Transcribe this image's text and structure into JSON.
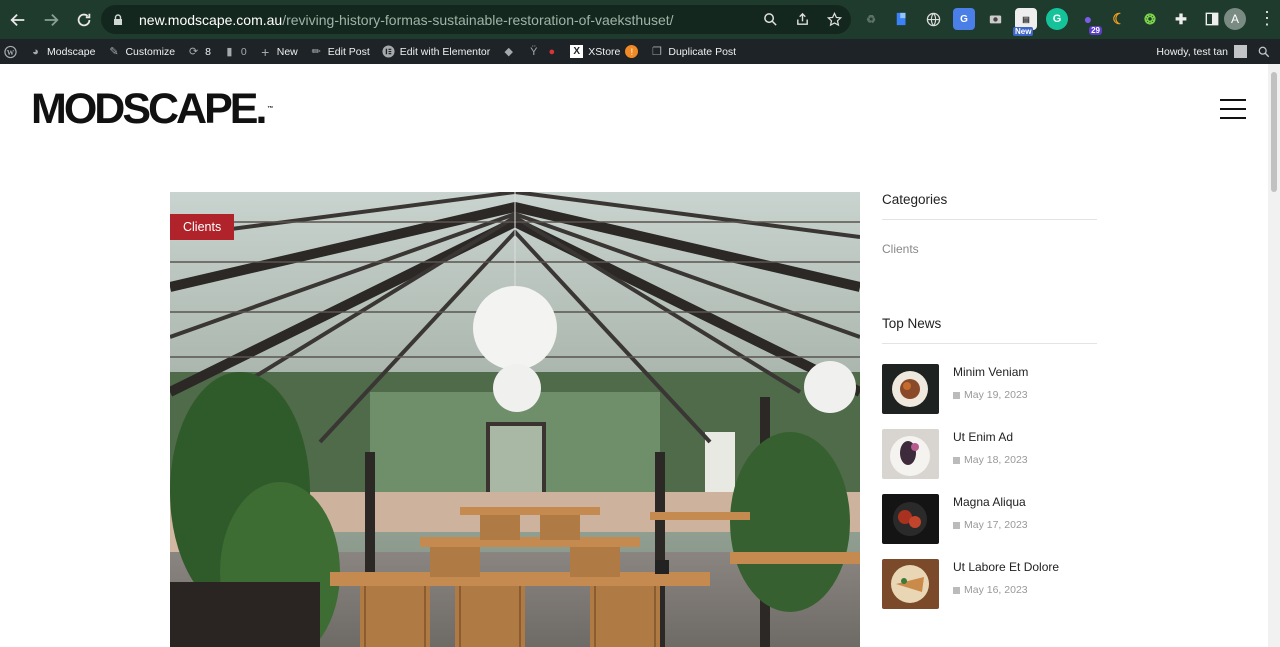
{
  "browser": {
    "url_host": "new.modscape.com.au",
    "url_path": "/reviving-history-formas-sustainable-restoration-of-vaeksthuset/",
    "profile_initial": "A",
    "ext_badge_new": "New",
    "ext_badge_count": "29"
  },
  "adminbar": {
    "site": "Modscape",
    "customize": "Customize",
    "updates": "8",
    "comments": "0",
    "new": "New",
    "edit_post": "Edit Post",
    "elementor": "Edit with Elementor",
    "xstore": "XStore",
    "duplicate": "Duplicate Post",
    "howdy": "Howdy, test tan"
  },
  "site": {
    "logo": "MODSCAPE.",
    "logo_tm": "™"
  },
  "post": {
    "category_badge": "Clients"
  },
  "sidebar": {
    "categories_title": "Categories",
    "categories": [
      "Clients"
    ],
    "top_news_title": "Top News",
    "news": [
      {
        "title": "Minim Veniam",
        "date": "May 19, 2023"
      },
      {
        "title": "Ut Enim Ad",
        "date": "May 18, 2023"
      },
      {
        "title": "Magna Aliqua",
        "date": "May 17, 2023"
      },
      {
        "title": "Ut Labore Et Dolore",
        "date": "May 16, 2023"
      }
    ]
  },
  "colors": {
    "chrome_bg": "#1f3b2d",
    "adminbar_bg": "#1d2327",
    "badge_red": "#b0232a"
  }
}
